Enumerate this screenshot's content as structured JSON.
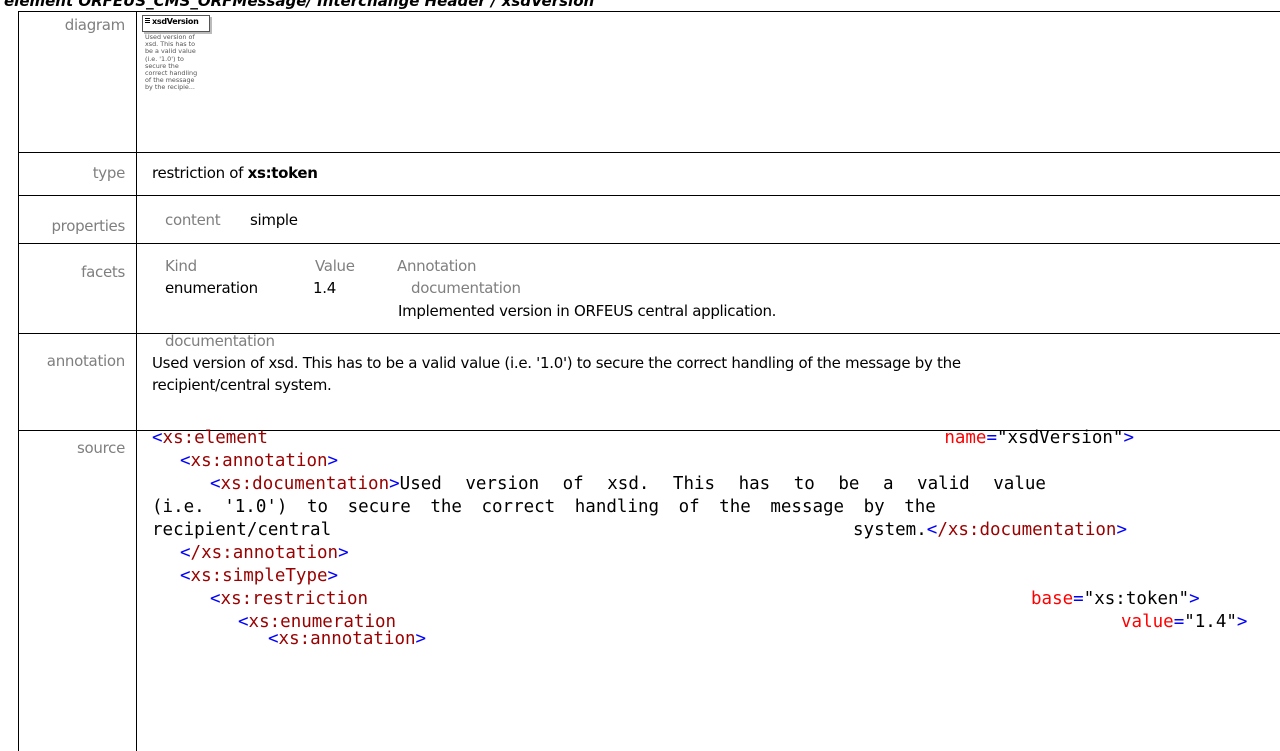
{
  "header": {
    "title": "element ORFEUS_CMS_ORFMessage/ Interchange Header / xsdVersion"
  },
  "labels": {
    "diagram": "diagram",
    "type": "type",
    "properties": "properties",
    "facets": "facets",
    "annotation": "annotation",
    "source": "source"
  },
  "diagram": {
    "element_name": "xsdVersion",
    "doc_lines": [
      "Used version of",
      "xsd. This has to",
      "be a valid value",
      "(i.e. '1.0') to",
      "secure the",
      "correct handling",
      "of the message",
      "by the recipie..."
    ]
  },
  "type": {
    "prefix": "restriction of ",
    "base": "xs:token"
  },
  "properties": {
    "key": "content",
    "value": "simple"
  },
  "facets": {
    "headers": [
      "Kind",
      "Value",
      "Annotation"
    ],
    "rows": [
      {
        "kind": "enumeration",
        "value": "1.4",
        "annotation_label": "documentation",
        "annotation_text": "Implemented version in ORFEUS central application."
      }
    ]
  },
  "annotation": {
    "label": "documentation",
    "line1": "Used version of xsd. This has to be a valid value (i.e. '1.0') to secure the correct handling of the message by the",
    "line2": "recipient/central system."
  },
  "source": {
    "l1_tag": "xs:element",
    "l1_attr": "name",
    "l1_val": "\"xsdVersion\"",
    "l2_tag": "xs:annotation",
    "l3_tag": "xs:documentation",
    "l3_text": "Used version of xsd. This has to be a valid value",
    "l4_text": "(i.e. '1.0') to secure the correct handling of the message by the",
    "l5_text_a": "recipient/central",
    "l5_text_b": "system.",
    "l5_close": "/xs:documentation",
    "l6_tag": "/xs:annotation",
    "l7_tag": "xs:simpleType",
    "l8_tag": "xs:restriction",
    "l8_attr": "base",
    "l8_val": "\"xs:token\"",
    "l9_tag": "xs:enumeration",
    "l9_attr": "value",
    "l9_val": "\"1.4\"",
    "l10_tag": "xs:annotation"
  },
  "colors": {
    "tag": "#990000",
    "punct": "#0000ff",
    "attr": "#ff0000",
    "label": "#7f7f7f"
  }
}
